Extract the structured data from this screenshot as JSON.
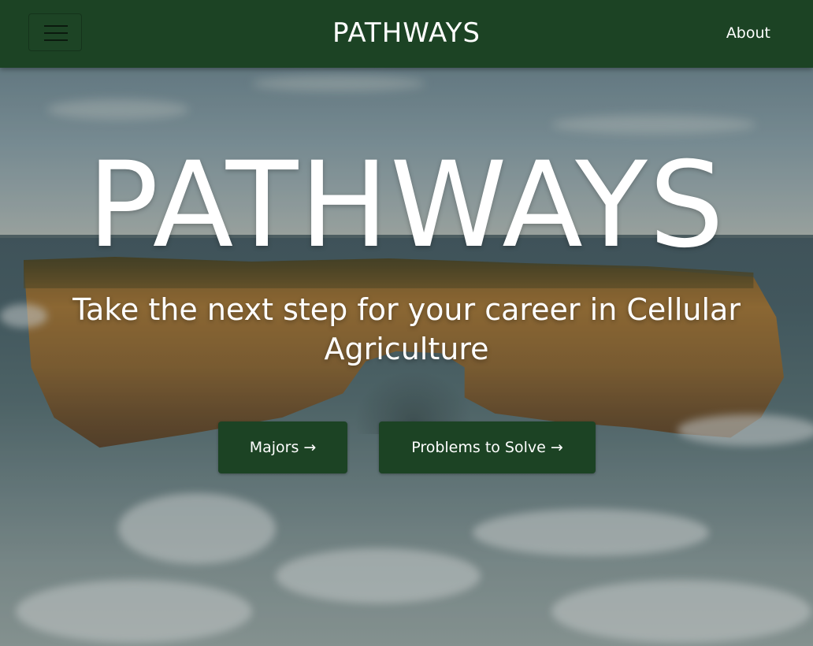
{
  "navbar": {
    "menu_icon": "hamburger-menu-icon",
    "brand": "PATHWAYS",
    "about_link": "About",
    "background": "#1c4324"
  },
  "hero": {
    "title": "PATHWAYS",
    "subtitle": "Take the next step for your career in Cellular Agriculture",
    "buttons": [
      {
        "label": "Majors →"
      },
      {
        "label": "Problems to Solve →"
      }
    ],
    "button_color": "#1c4324"
  }
}
